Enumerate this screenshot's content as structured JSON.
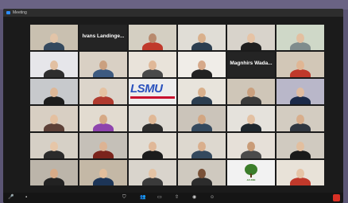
{
  "window": {
    "title": "Meeting"
  },
  "gallery": {
    "rows": [
      [
        {
          "name": "",
          "label": "",
          "type": "video",
          "bg": "#c9c0b0",
          "skin": "#e2c4a8",
          "shirt": "#34495e"
        },
        {
          "name": "",
          "label": "Ivans Landinge...",
          "type": "text"
        },
        {
          "name": "",
          "label": "",
          "type": "video",
          "bg": "#d4cfc2",
          "skin": "#b88a6e",
          "shirt": "#c0392b"
        },
        {
          "name": "",
          "label": "",
          "type": "video",
          "bg": "#e0ddd6",
          "skin": "#d9b08c",
          "shirt": "#2c3e50"
        },
        {
          "name": "",
          "label": "",
          "type": "video",
          "bg": "#d8d3cb",
          "skin": "#e6c3a5",
          "shirt": "#1f1f1f"
        },
        {
          "name": "",
          "label": "",
          "type": "video",
          "bg": "#cfd8c8",
          "skin": "#e3bfa0",
          "shirt": "#7f8c8d"
        }
      ],
      [
        {
          "name": "",
          "label": "",
          "type": "video",
          "bg": "#e6e6ea",
          "skin": "#e2c0a2",
          "shirt": "#2e2e2e"
        },
        {
          "name": "",
          "label": "",
          "type": "video",
          "bg": "#d9d0c4",
          "skin": "#caa080",
          "shirt": "#3d5a80"
        },
        {
          "name": "",
          "label": "",
          "type": "video",
          "bg": "#e9e3da",
          "skin": "#e0b898",
          "shirt": "#4a4a4a"
        },
        {
          "name": "",
          "label": "",
          "type": "video",
          "bg": "#f0ede8",
          "skin": "#d6a98a",
          "shirt": "#222222"
        },
        {
          "name": "",
          "label": "Magnhirs Wada...",
          "type": "text"
        },
        {
          "name": "",
          "label": "",
          "type": "video",
          "bg": "#d2c7b7",
          "skin": "#e0b694",
          "shirt": "#c0392b"
        }
      ],
      [
        {
          "name": "",
          "label": "",
          "type": "video",
          "bg": "#c7c9cc",
          "skin": "#ddb898",
          "shirt": "#1d1d1d"
        },
        {
          "name": "",
          "label": "",
          "type": "video",
          "bg": "#dcd5cb",
          "skin": "#e5c2a2",
          "shirt": "#b03a2e"
        },
        {
          "name": "",
          "label": "LSMU",
          "type": "logo"
        },
        {
          "name": "",
          "label": "",
          "type": "video",
          "bg": "#e8e4dc",
          "skin": "#d9b08c",
          "shirt": "#2c3e50"
        },
        {
          "name": "",
          "label": "",
          "type": "video",
          "bg": "#cfc6b8",
          "skin": "#caa07e",
          "shirt": "#3b3b3b"
        },
        {
          "name": "",
          "label": "",
          "type": "video",
          "bg": "#b9b7c9",
          "skin": "#e0bca0",
          "shirt": "#1b2a49"
        }
      ],
      [
        {
          "name": "",
          "label": "",
          "type": "video",
          "bg": "#d8cfc3",
          "skin": "#e4c0a0",
          "shirt": "#5d4037"
        },
        {
          "name": "",
          "label": "",
          "type": "video",
          "bg": "#e2dbd0",
          "skin": "#d6a985",
          "shirt": "#8e44ad"
        },
        {
          "name": "",
          "label": "",
          "type": "video",
          "bg": "#dedad3",
          "skin": "#e0b896",
          "shirt": "#2d2d2d"
        },
        {
          "name": "",
          "label": "",
          "type": "video",
          "bg": "#cbc4ba",
          "skin": "#d2a682",
          "shirt": "#34495e"
        },
        {
          "name": "",
          "label": "",
          "type": "video",
          "bg": "#e5e2dc",
          "skin": "#e3c1a3",
          "shirt": "#1e272e"
        },
        {
          "name": "",
          "label": "",
          "type": "video",
          "bg": "#d3ccc1",
          "skin": "#d8ae8c",
          "shirt": "#2f3640"
        }
      ],
      [
        {
          "name": "",
          "label": "",
          "type": "video",
          "bg": "#d6d0c6",
          "skin": "#e6c6a8",
          "shirt": "#2b2b2b"
        },
        {
          "name": "",
          "label": "",
          "type": "video",
          "bg": "#c5c0b8",
          "skin": "#dcb394",
          "shirt": "#7b241c"
        },
        {
          "name": "",
          "label": "",
          "type": "video",
          "bg": "#e1dcd3",
          "skin": "#e0b898",
          "shirt": "#1c1c1c"
        },
        {
          "name": "",
          "label": "",
          "type": "video",
          "bg": "#ddd8cf",
          "skin": "#d9af8d",
          "shirt": "#34495e"
        },
        {
          "name": "",
          "label": "",
          "type": "video",
          "bg": "#e6e0d8",
          "skin": "#c99c78",
          "shirt": "#4b4b4b"
        },
        {
          "name": "",
          "label": "",
          "type": "video",
          "bg": "#d0cac0",
          "skin": "#e2bf9f",
          "shirt": "#1a1a1a"
        }
      ],
      [
        {
          "name": "",
          "label": "",
          "type": "video",
          "bg": "#bcb5aa",
          "skin": "#d7ab88",
          "shirt": "#222222"
        },
        {
          "name": "",
          "label": "",
          "type": "video",
          "bg": "#c4b8a6",
          "skin": "#e2be9c",
          "shirt": "#1d3557"
        },
        {
          "name": "",
          "label": "",
          "type": "video",
          "bg": "#d9d4cc",
          "skin": "#e4c3a4",
          "shirt": "#3a3a3a"
        },
        {
          "name": "",
          "label": "",
          "type": "video",
          "bg": "#cfc9bf",
          "skin": "#7a5238",
          "shirt": "#2c2c2c"
        },
        {
          "name": "",
          "label": "JAUNIE",
          "type": "brand"
        },
        {
          "name": "",
          "label": "",
          "type": "video",
          "bg": "#e8e2d8",
          "skin": "#e6c4a6",
          "shirt": "#c0392b"
        }
      ]
    ]
  },
  "toolbar": {
    "buttons": [
      {
        "id": "mute",
        "glyph": "🎤",
        "label": ""
      },
      {
        "id": "video",
        "glyph": "▪",
        "label": ""
      },
      {
        "id": "security",
        "glyph": "⛉",
        "label": ""
      },
      {
        "id": "participants",
        "glyph": "👥",
        "label": ""
      },
      {
        "id": "chat",
        "glyph": "▭",
        "label": ""
      },
      {
        "id": "share",
        "glyph": "⇧",
        "label": ""
      },
      {
        "id": "record",
        "glyph": "◉",
        "label": ""
      },
      {
        "id": "reactions",
        "glyph": "☺",
        "label": ""
      }
    ]
  },
  "colors": {
    "accent": "#2d8cff",
    "end": "#d93025",
    "speaker": "#d8f000"
  }
}
